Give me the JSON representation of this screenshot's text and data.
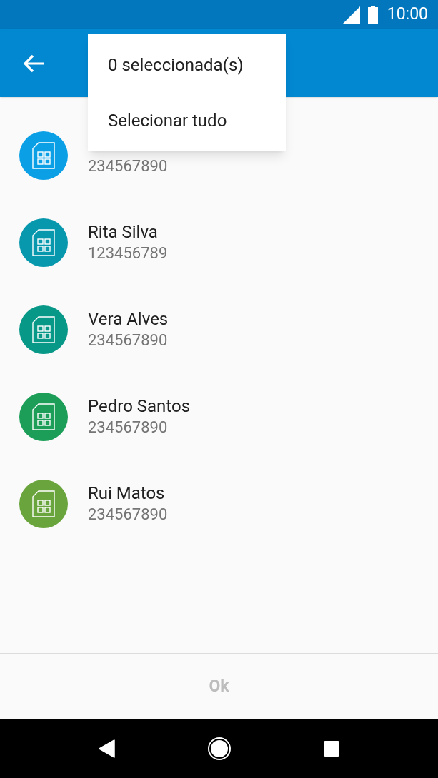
{
  "status_bar": {
    "time": "10:00"
  },
  "menu": {
    "items": [
      {
        "label": "0 seleccionada(s)"
      },
      {
        "label": "Selecionar tudo"
      }
    ]
  },
  "contacts": [
    {
      "number": "234567890",
      "color": "#0ba0e6"
    },
    {
      "name": "Rita Silva",
      "number": "123456789",
      "color": "#0798ad"
    },
    {
      "name": "Vera Alves",
      "number": "234567890",
      "color": "#079888"
    },
    {
      "name": "Pedro Santos",
      "number": "234567890",
      "color": "#1c9e58"
    },
    {
      "name": "Rui Matos",
      "number": "234567890",
      "color": "#6aa43c"
    }
  ],
  "ok_button": {
    "label": "Ok",
    "disabled": true
  }
}
